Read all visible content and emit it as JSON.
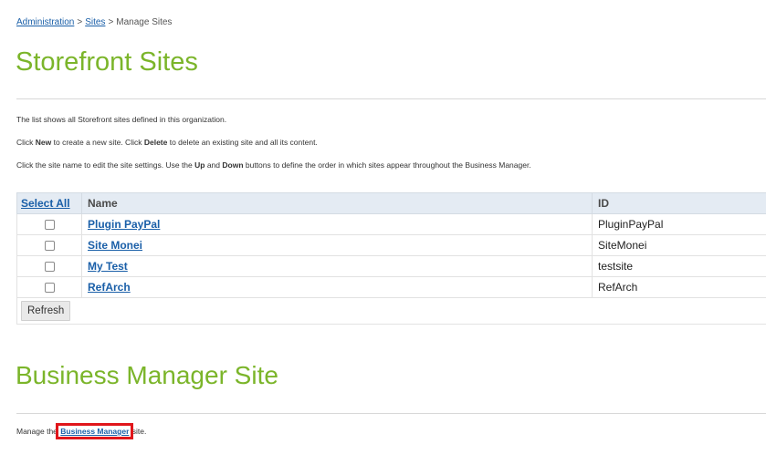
{
  "breadcrumb": {
    "items": [
      "Administration",
      "Sites",
      "Manage Sites"
    ],
    "separator": ">"
  },
  "page_title": "Storefront Sites",
  "info": {
    "line1": "The list shows all Storefront sites defined in this organization.",
    "line2": {
      "p1": "Click ",
      "b1": "New",
      "p2": " to create a new site. Click ",
      "b2": "Delete",
      "p3": " to delete an existing site and all its content."
    },
    "line3": {
      "p1": "Click the site name to edit the site settings. Use the ",
      "b1": "Up",
      "p2": " and ",
      "b2": "Down",
      "p3": " buttons to define the order in which sites appear throughout the Business Manager."
    }
  },
  "table": {
    "headers": {
      "select_all": "Select All",
      "name": "Name",
      "id": "ID"
    },
    "rows": [
      {
        "name": "Plugin PayPal",
        "id": "PluginPayPal"
      },
      {
        "name": "Site Monei",
        "id": "SiteMonei"
      },
      {
        "name": "My Test",
        "id": "testsite"
      },
      {
        "name": "RefArch",
        "id": "RefArch"
      }
    ],
    "refresh_label": "Refresh"
  },
  "bm_section": {
    "title": "Business Manager Site",
    "text_before": "Manage the ",
    "link": "Business Manager",
    "text_after": " site."
  },
  "colors": {
    "title_green": "#7bb52a",
    "link_blue": "#1a5fa8",
    "header_bg": "#e4ebf3",
    "highlight_red": "#e0161b"
  }
}
